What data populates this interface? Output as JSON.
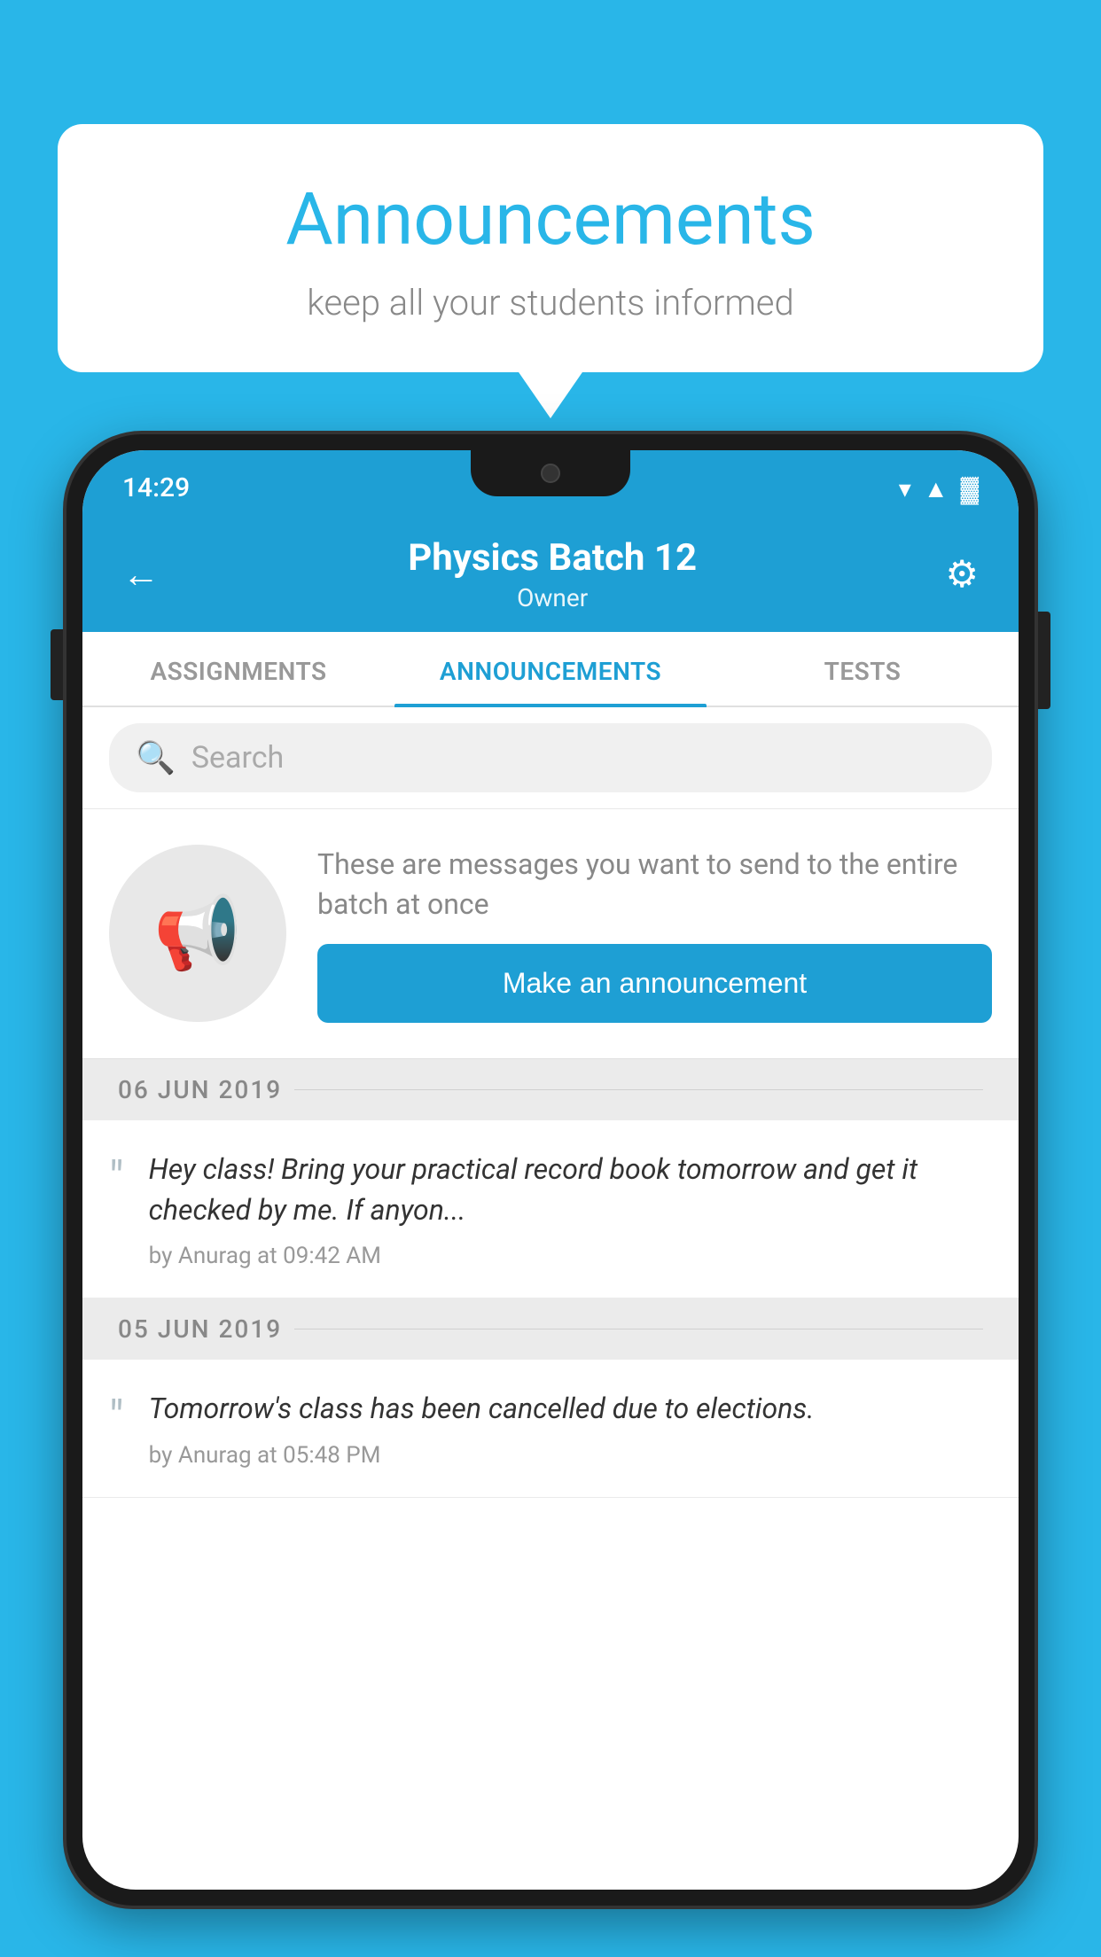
{
  "background_color": "#29b6e8",
  "speech_bubble": {
    "title": "Announcements",
    "subtitle": "keep all your students informed"
  },
  "phone": {
    "status_bar": {
      "time": "14:29",
      "wifi": "▼",
      "signal": "▲",
      "battery": "▓"
    },
    "header": {
      "back_label": "←",
      "title": "Physics Batch 12",
      "subtitle": "Owner",
      "settings_label": "⚙"
    },
    "tabs": [
      {
        "id": "assignments",
        "label": "ASSIGNMENTS",
        "active": false
      },
      {
        "id": "announcements",
        "label": "ANNOUNCEMENTS",
        "active": true
      },
      {
        "id": "tests",
        "label": "TESTS",
        "active": false
      }
    ],
    "search": {
      "placeholder": "Search"
    },
    "announcement_prompt": {
      "description": "These are messages you want to send to the entire batch at once",
      "button_label": "Make an announcement"
    },
    "date_sections": [
      {
        "date": "06  JUN  2019",
        "items": [
          {
            "text": "Hey class! Bring your practical record book tomorrow and get it checked by me. If anyon...",
            "meta": "by Anurag at 09:42 AM"
          }
        ]
      },
      {
        "date": "05  JUN  2019",
        "items": [
          {
            "text": "Tomorrow's class has been cancelled due to elections.",
            "meta": "by Anurag at 05:48 PM"
          }
        ]
      }
    ]
  }
}
